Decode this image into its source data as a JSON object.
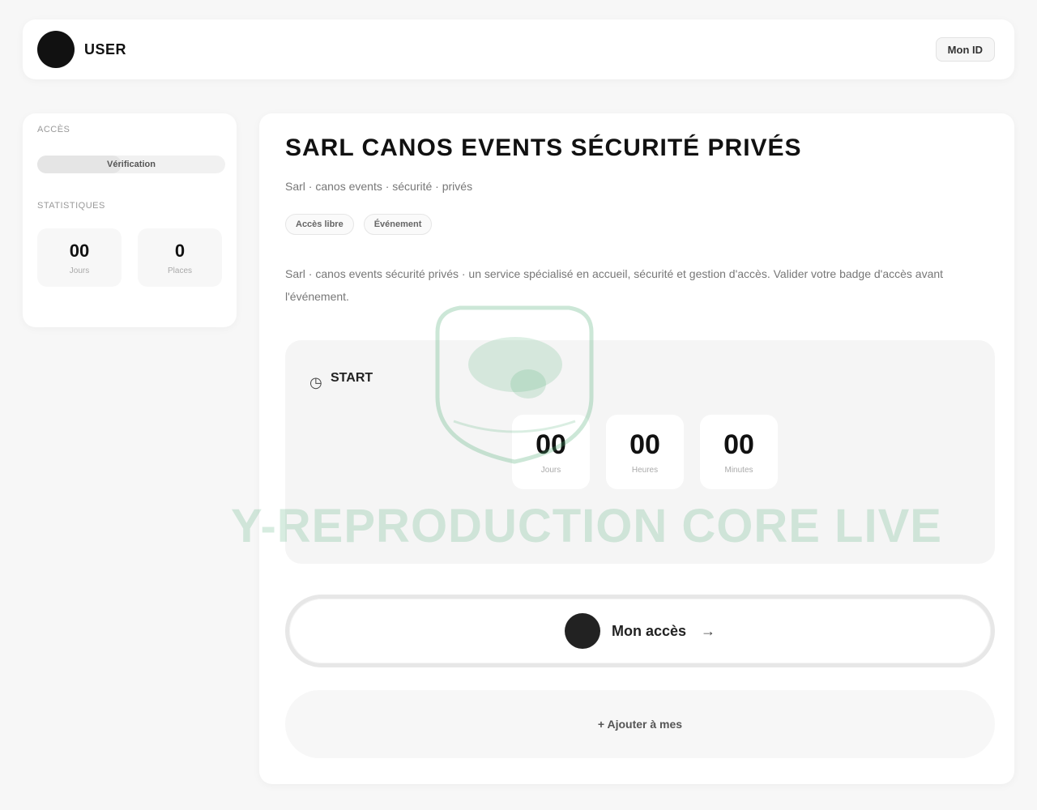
{
  "brand": {
    "name": "USER"
  },
  "header": {
    "button_label": "Mon ID"
  },
  "sidebar": {
    "section1_label": "Accès",
    "progress_label": "Vérification",
    "progress_fraction": 0.45,
    "section2_label": "Statistiques",
    "stats": [
      {
        "value": "00",
        "label": "Jours"
      },
      {
        "value": "0",
        "label": "Places"
      }
    ]
  },
  "main": {
    "title": "SARL CANOS EVENTS SÉCURITÉ PRIVÉS",
    "subtitle": "Sarl · canos events · sécurité · privés",
    "badges": [
      "Accès libre",
      "Événement"
    ],
    "description": "Sarl · canos events sécurité privés · un service spécialisé en accueil, sécurité et gestion d'accès. Valider votre badge d'accès avant l'événement."
  },
  "countdown": {
    "label": "START",
    "items": [
      {
        "value": "00",
        "unit": "Jours"
      },
      {
        "value": "00",
        "unit": "Heures"
      },
      {
        "value": "00",
        "unit": "Minutes"
      }
    ]
  },
  "watermark": {
    "text": "Y-REPRODUCTION CORE LIVE"
  },
  "primary_button": {
    "label": "Mon accès",
    "arrow": "→"
  },
  "secondary_button": {
    "label": "+ Ajouter à mes"
  },
  "icons": {
    "clock": "clock-icon",
    "avatar": "avatar-icon",
    "arrow": "arrow-right-icon"
  },
  "colors": {
    "accent": "#111111",
    "stamp_green": "#48aa70",
    "panel_bg": "#f5f5f5"
  }
}
